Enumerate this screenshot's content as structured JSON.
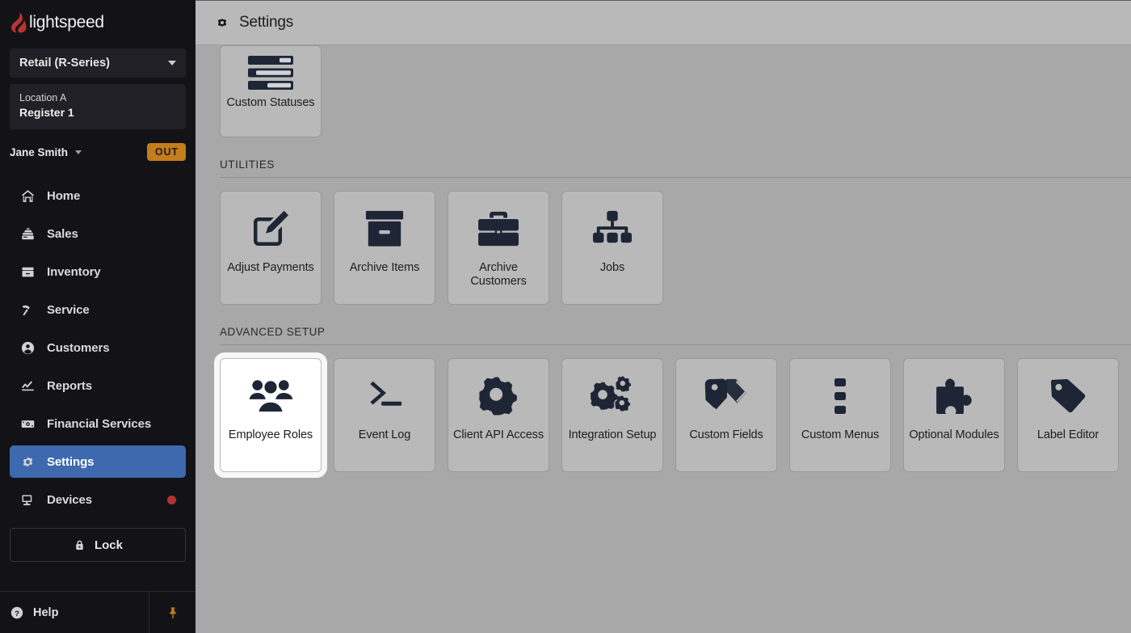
{
  "sidebar": {
    "brand": {
      "name": "lightspeed",
      "icon": "flame-logo-icon"
    },
    "series_select": {
      "label": "Retail (R-Series)",
      "icon": "chevron-down-icon"
    },
    "location": {
      "line1": "Location A",
      "line2": "Register 1"
    },
    "user": {
      "name": "Jane Smith",
      "status_badge": "OUT",
      "caret_icon": "caret-down-icon"
    },
    "nav": [
      {
        "label": "Home",
        "icon": "home-icon",
        "active": false
      },
      {
        "label": "Sales",
        "icon": "cash-register-icon",
        "active": false
      },
      {
        "label": "Inventory",
        "icon": "inventory-box-icon",
        "active": false
      },
      {
        "label": "Service",
        "icon": "hammer-icon",
        "active": false
      },
      {
        "label": "Customers",
        "icon": "user-circle-icon",
        "active": false
      },
      {
        "label": "Reports",
        "icon": "line-chart-icon",
        "active": false
      },
      {
        "label": "Financial Services",
        "icon": "banknote-icon",
        "active": false
      },
      {
        "label": "Settings",
        "icon": "gear-icon",
        "active": true
      },
      {
        "label": "Devices",
        "icon": "monitor-icon",
        "active": false,
        "badge_dot": true
      }
    ],
    "lock_button": {
      "label": "Lock",
      "icon": "padlock-icon"
    },
    "footer": {
      "help": {
        "label": "Help",
        "icon": "question-circle-icon"
      },
      "pin": {
        "icon": "pushpin-icon"
      }
    }
  },
  "topbar": {
    "title": "Settings",
    "icon": "gear-icon"
  },
  "content": {
    "sections": [
      {
        "heading": "",
        "show_heading": false,
        "cards": [
          {
            "label": "Custom Statuses",
            "icon": "status-bars-icon",
            "clipped": true,
            "selected": false
          }
        ]
      },
      {
        "heading": "UTILITIES",
        "show_heading": true,
        "cards": [
          {
            "label": "Adjust Payments",
            "icon": "edit-square-pencil-icon",
            "selected": false
          },
          {
            "label": "Archive Items",
            "icon": "archive-box-icon",
            "selected": false
          },
          {
            "label": "Archive Customers",
            "icon": "briefcase-icon",
            "selected": false
          },
          {
            "label": "Jobs",
            "icon": "org-chart-icon",
            "selected": false
          }
        ]
      },
      {
        "heading": "ADVANCED SETUP",
        "show_heading": true,
        "cards": [
          {
            "label": "Employee Roles",
            "icon": "people-group-icon",
            "selected": true
          },
          {
            "label": "Event Log",
            "icon": "terminal-prompt-icon",
            "selected": false
          },
          {
            "label": "Client API Access",
            "icon": "gear-icon",
            "selected": false
          },
          {
            "label": "Integration Setup",
            "icon": "multi-gears-icon",
            "selected": false
          },
          {
            "label": "Custom Fields",
            "icon": "tags-icon",
            "selected": false
          },
          {
            "label": "Custom Menus",
            "icon": "vertical-dots-icon",
            "selected": false
          },
          {
            "label": "Optional Modules",
            "icon": "puzzle-piece-icon",
            "selected": false
          },
          {
            "label": "Label Editor",
            "icon": "tag-icon",
            "selected": false
          }
        ]
      }
    ]
  },
  "colors": {
    "sidebar_bg": "#131317",
    "active_nav": "#3f69af",
    "badge_out": "#c47c1c",
    "brand_flame": "#b5352f",
    "content_bg": "#a8a8a8",
    "card_bg": "#b9b9b9",
    "card_icon": "#1e2636",
    "devices_dot": "#b5322f"
  }
}
